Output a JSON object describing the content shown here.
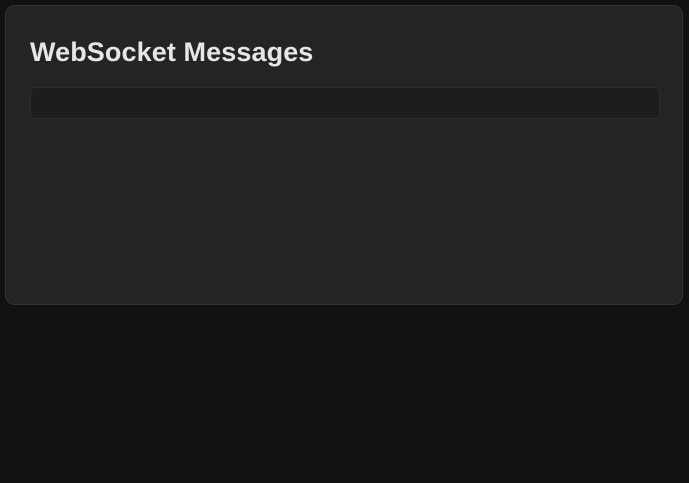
{
  "panel": {
    "title": "WebSocket Messages"
  },
  "messages": []
}
